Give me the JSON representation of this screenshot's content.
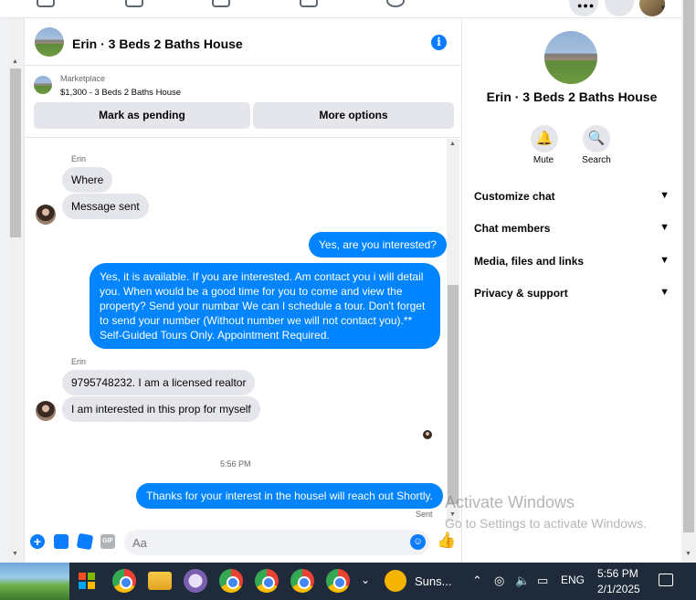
{
  "chat": {
    "title": "Erin · 3 Beds 2 Baths House",
    "info_icon": "info-icon",
    "marketplace": {
      "label": "Marketplace",
      "listing": "$1,300 - 3 Beds 2 Baths House",
      "primary_button": "Mark as pending",
      "secondary_button": "More options"
    },
    "messages": [
      {
        "from": "Erin",
        "sender_label": "Erin",
        "text": "Where"
      },
      {
        "from": "Erin",
        "text": "Message sent"
      },
      {
        "from": "me",
        "text": "Yes, are you interested?"
      },
      {
        "from": "me",
        "text": "Yes, it is available. If you are interested.  Am contact you i will detail you.  When would be a good time for you to come and view the property? Send your numbar We can I schedule a tour.  Don't forget to send your number (Without number we will not contact you).** Self-Guided Tours Only. Appointment Required."
      },
      {
        "from": "Erin",
        "sender_label": "Erin",
        "text": "9795748232. I am a licensed realtor"
      },
      {
        "from": "Erin",
        "text": "I am interested in this prop for myself"
      },
      {
        "from": "me",
        "text": "Thanks for your interest in the housel will reach out Shortly."
      }
    ],
    "timestamp": "5:56 PM",
    "sent_status": "Sent",
    "composer": {
      "placeholder": "Aa",
      "icons": [
        "plus-icon",
        "image-icon",
        "sticker-icon",
        "gif-icon",
        "emoji-icon",
        "like-icon"
      ],
      "gif_label": "GIF"
    }
  },
  "details": {
    "title": "Erin · 3 Beds 2 Baths House",
    "actions": [
      {
        "label": "Mute",
        "icon": "bell-icon"
      },
      {
        "label": "Search",
        "icon": "search-icon"
      }
    ],
    "sections": [
      {
        "label": "Customize chat"
      },
      {
        "label": "Chat members"
      },
      {
        "label": "Media, files and links"
      },
      {
        "label": "Privacy & support"
      }
    ]
  },
  "watermark": {
    "line1": "Activate Windows",
    "line2": "Go to Settings to activate Windows."
  },
  "taskbar": {
    "weather": "Suns...",
    "language": "ENG",
    "time": "5:56 PM",
    "date": "2/1/2025"
  },
  "colors": {
    "accent": "#0084ff",
    "bubble_in": "#e4e6eb",
    "taskbar": "#1f2b3a"
  }
}
